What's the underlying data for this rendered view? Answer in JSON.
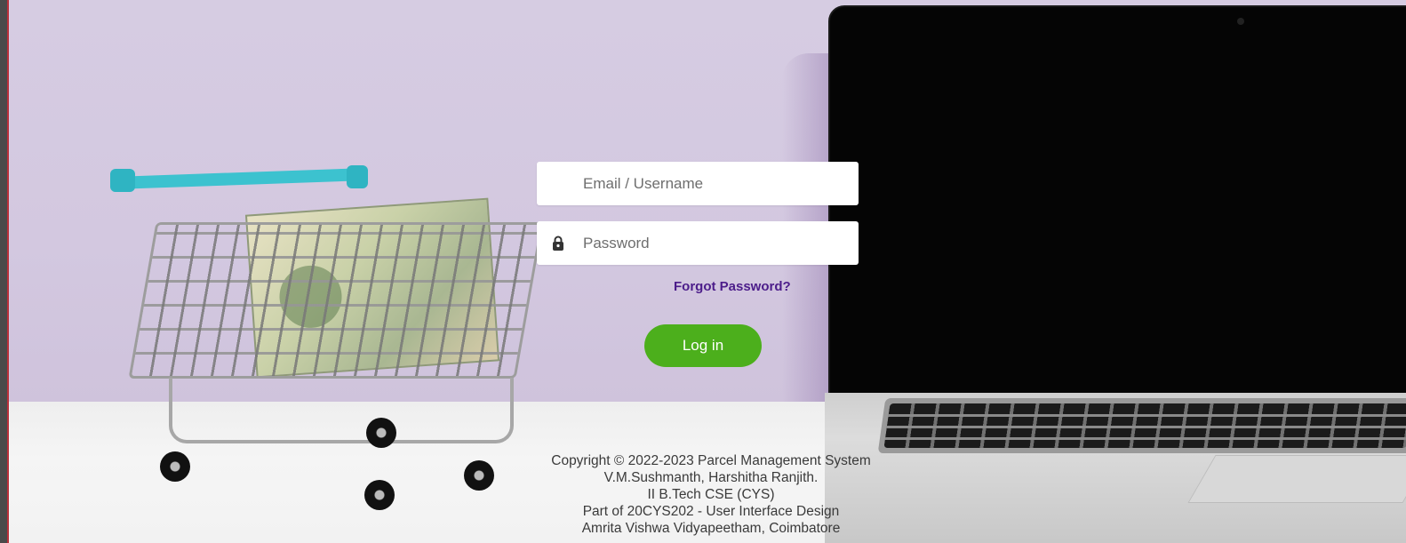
{
  "login": {
    "email_placeholder": "Email / Username",
    "password_placeholder": "Password",
    "forgot_password": "Forgot Password?",
    "login_button": "Log in"
  },
  "footer": {
    "lines": [
      "Copyright © 2022-2023 Parcel Management System",
      "V.M.Sushmanth, Harshitha Ranjith.",
      "II B.Tech CSE (CYS)",
      "Part of 20CYS202 - User Interface Design",
      "Amrita Vishwa Vidyapeetham, Coimbatore"
    ]
  },
  "icons": {
    "password_field": "lock-icon"
  },
  "colors": {
    "login_button": "#4caf1c",
    "forgot_link": "#4c1d8a",
    "wall": "#d6cce2"
  }
}
